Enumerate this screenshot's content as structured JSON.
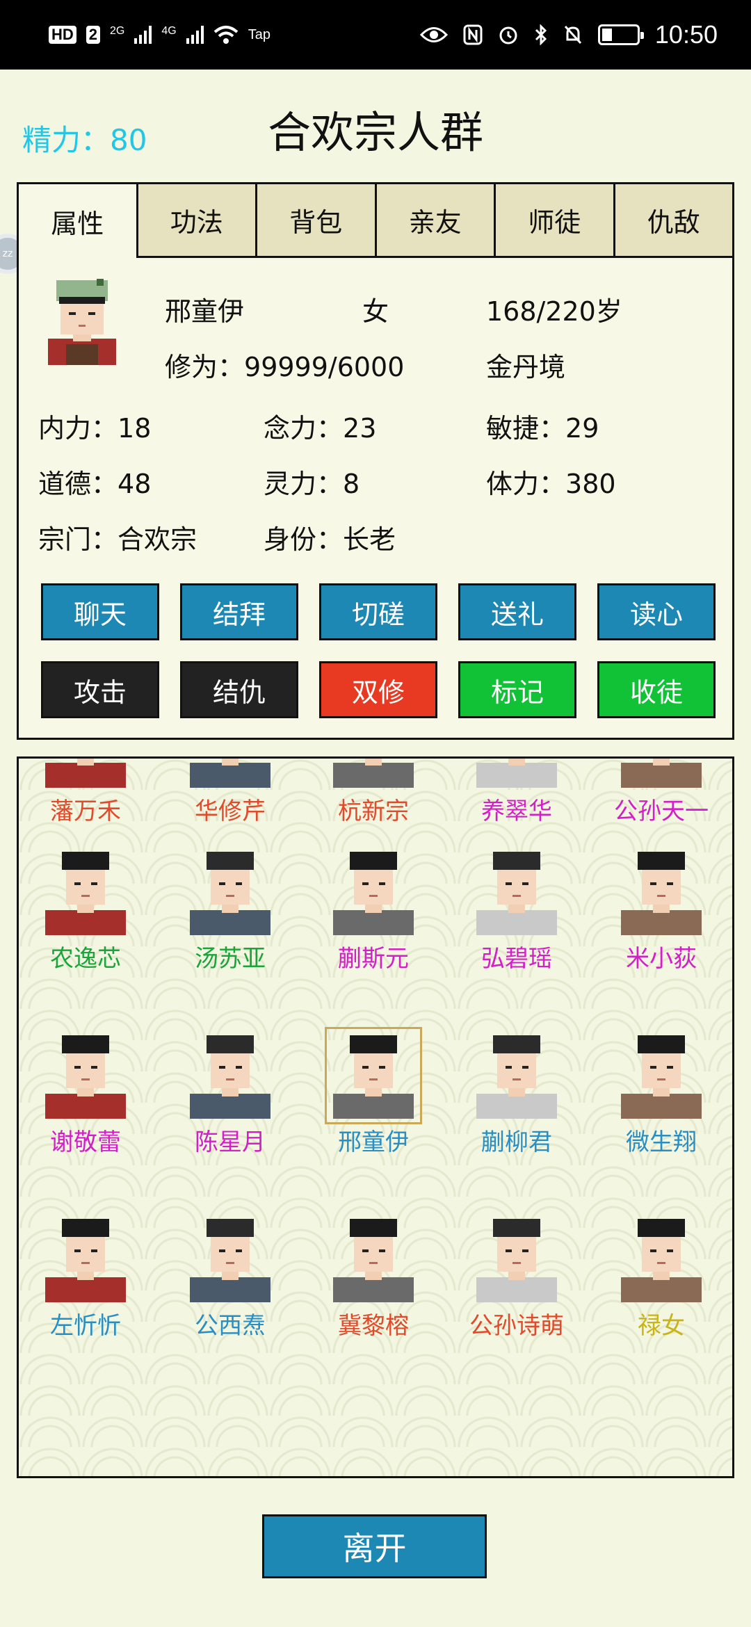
{
  "status_bar": {
    "left_labels": [
      "HD",
      "2",
      "2G",
      "4G",
      "Tap"
    ],
    "time": "10:50"
  },
  "header": {
    "stamina_label": "精力：",
    "stamina_value": "80",
    "title": "合欢宗人群"
  },
  "tabs": [
    "属性",
    "功法",
    "背包",
    "亲友",
    "师徒",
    "仇敌"
  ],
  "profile": {
    "name": "邢童伊",
    "gender": "女",
    "age": "168/220岁",
    "cultivation_label": "修为：",
    "cultivation_value": "99999/6000",
    "realm": "金丹境",
    "stats": [
      {
        "label": "内力：",
        "value": "18"
      },
      {
        "label": "念力：",
        "value": "23"
      },
      {
        "label": "敏捷：",
        "value": "29"
      },
      {
        "label": "道德：",
        "value": "48"
      },
      {
        "label": "灵力：",
        "value": "8"
      },
      {
        "label": "体力：",
        "value": "380"
      }
    ],
    "sect_label": "宗门：",
    "sect_value": "合欢宗",
    "identity_label": "身份：",
    "identity_value": "长老"
  },
  "actions_row1": [
    "聊天",
    "结拜",
    "切磋",
    "送礼",
    "读心"
  ],
  "actions_row2": [
    "攻击",
    "结仇",
    "双修",
    "标记",
    "收徒"
  ],
  "colors": {
    "red": "#e24a2c",
    "green": "#1aa53a",
    "magenta": "#d21fc7",
    "blue": "#2a8ec2",
    "yellow": "#c9b416",
    "button_blue": "#1e88b4",
    "button_dark": "#222222",
    "button_red": "#e83a22",
    "button_green": "#11c236"
  },
  "people": [
    {
      "name": "藩万禾",
      "color": "#e24a2c"
    },
    {
      "name": "华修芹",
      "color": "#e24a2c"
    },
    {
      "name": "杭新宗",
      "color": "#e24a2c"
    },
    {
      "name": "养翠华",
      "color": "#d21fc7"
    },
    {
      "name": "公孙天一",
      "color": "#d21fc7"
    },
    {
      "name": "农逸芯",
      "color": "#1aa53a"
    },
    {
      "name": "汤苏亚",
      "color": "#1aa53a"
    },
    {
      "name": "蒯斯元",
      "color": "#d21fc7"
    },
    {
      "name": "弘碧瑶",
      "color": "#d21fc7"
    },
    {
      "name": "米小荻",
      "color": "#d21fc7"
    },
    {
      "name": "谢敬蕾",
      "color": "#d21fc7"
    },
    {
      "name": "陈星月",
      "color": "#d21fc7"
    },
    {
      "name": "邢童伊",
      "color": "#2a8ec2"
    },
    {
      "name": "蒯柳君",
      "color": "#2a8ec2"
    },
    {
      "name": "微生翔",
      "color": "#2a8ec2"
    },
    {
      "name": "左忻忻",
      "color": "#2a8ec2"
    },
    {
      "name": "公西焘",
      "color": "#2a8ec2"
    },
    {
      "name": "冀黎榕",
      "color": "#e24a2c"
    },
    {
      "name": "公孙诗萌",
      "color": "#e24a2c"
    },
    {
      "name": "禄女",
      "color": "#c9b416"
    }
  ],
  "leave_button": "离开",
  "side_handle": "zz"
}
